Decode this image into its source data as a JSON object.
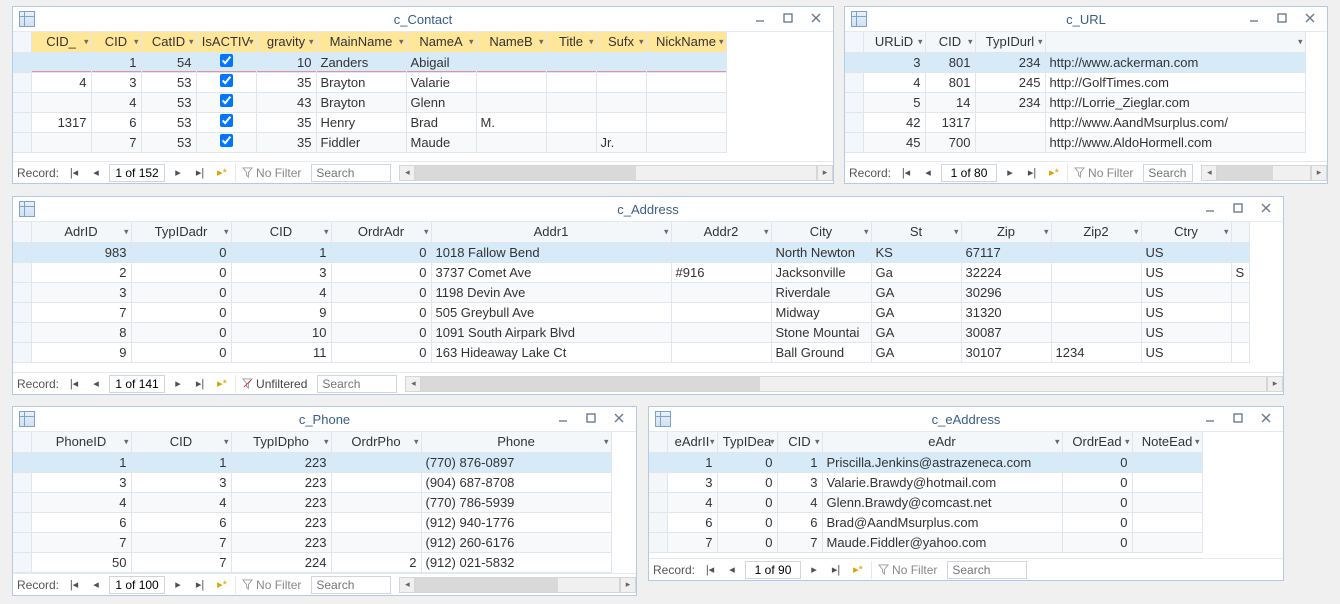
{
  "icons": {
    "minimize": "minimize",
    "maximize": "maximize",
    "close": "close"
  },
  "common": {
    "record_label": "Record:",
    "nofilter_label": "No Filter",
    "unfiltered_label": "Unfiltered",
    "search_placeholder": "Search"
  },
  "windows": {
    "contact": {
      "title": "c_Contact",
      "record": "1 of 152",
      "headers": [
        "CID_",
        "CID",
        "CatID",
        "IsACTIV",
        "gravity",
        "MainName",
        "NameA",
        "NameB",
        "Title",
        "Sufx",
        "NickName"
      ],
      "rows": [
        {
          "sel": true,
          "pink": true,
          "CID_": "",
          "CID": "1",
          "CatID": "54",
          "IsACTIV": true,
          "gravity": "10",
          "MainName": "Zanders",
          "NameA": "Abigail",
          "NameB": "",
          "Title": "",
          "Sufx": "",
          "NickName": ""
        },
        {
          "CID_": "4",
          "CID": "3",
          "CatID": "53",
          "IsACTIV": true,
          "gravity": "35",
          "MainName": "Brayton",
          "NameA": "Valarie",
          "NameB": "",
          "Title": "",
          "Sufx": "",
          "NickName": ""
        },
        {
          "CID_": "",
          "CID": "4",
          "CatID": "53",
          "IsACTIV": true,
          "gravity": "43",
          "MainName": "Brayton",
          "NameA": "Glenn",
          "NameB": "",
          "Title": "",
          "Sufx": "",
          "NickName": ""
        },
        {
          "CID_": "1317",
          "CID": "6",
          "CatID": "53",
          "IsACTIV": true,
          "gravity": "35",
          "MainName": "Henry",
          "NameA": "Brad",
          "NameB": "M.",
          "Title": "",
          "Sufx": "",
          "NickName": ""
        },
        {
          "CID_": "",
          "CID": "7",
          "CatID": "53",
          "IsACTIV": true,
          "gravity": "35",
          "MainName": "Fiddler",
          "NameA": "Maude",
          "NameB": "",
          "Title": "",
          "Sufx": "Jr.",
          "NickName": ""
        }
      ]
    },
    "url": {
      "title": "c_URL",
      "record": "1 of 80",
      "headers": [
        "URLiD",
        "CID",
        "TypIDurl",
        ""
      ],
      "rows": [
        {
          "sel": true,
          "URLiD": "3",
          "CID": "801",
          "TypIDurl": "234",
          "url": "http://www.ackerman.com"
        },
        {
          "URLiD": "4",
          "CID": "801",
          "TypIDurl": "245",
          "url": "http://GolfTimes.com"
        },
        {
          "URLiD": "5",
          "CID": "14",
          "TypIDurl": "234",
          "url": "http://Lorrie_Zieglar.com"
        },
        {
          "URLiD": "42",
          "CID": "1317",
          "TypIDurl": "",
          "url": "http://www.AandMsurplus.com/"
        },
        {
          "URLiD": "45",
          "CID": "700",
          "TypIDurl": "",
          "url": "http://www.AldoHormell.com"
        }
      ]
    },
    "address": {
      "title": "c_Address",
      "record": "1 of 141",
      "filter": "Unfiltered",
      "headers": [
        "AdrID",
        "TypIDadr",
        "CID",
        "OrdrAdr",
        "Addr1",
        "Addr2",
        "City",
        "St",
        "Zip",
        "Zip2",
        "Ctry"
      ],
      "rows": [
        {
          "sel": true,
          "AdrID": "983",
          "TypIDadr": "0",
          "CID": "1",
          "OrdrAdr": "0",
          "Addr1": "1018 Fallow Bend",
          "Addr2": "",
          "City": "North Newton",
          "St": "KS",
          "Zip": "67117",
          "Zip2": "",
          "Ctry": "US",
          "extra": ""
        },
        {
          "AdrID": "2",
          "TypIDadr": "0",
          "CID": "3",
          "OrdrAdr": "0",
          "Addr1": "3737 Comet Ave",
          "Addr2": "#916",
          "City": "Jacksonville",
          "St": "Ga",
          "Zip": "32224",
          "Zip2": "",
          "Ctry": "US",
          "extra": "S"
        },
        {
          "AdrID": "3",
          "TypIDadr": "0",
          "CID": "4",
          "OrdrAdr": "0",
          "Addr1": "1198 Devin Ave",
          "Addr2": "",
          "City": "Riverdale",
          "St": "GA",
          "Zip": "30296",
          "Zip2": "",
          "Ctry": "US",
          "extra": ""
        },
        {
          "AdrID": "7",
          "TypIDadr": "0",
          "CID": "9",
          "OrdrAdr": "0",
          "Addr1": "505 Greybull Ave",
          "Addr2": "",
          "City": "Midway",
          "St": "GA",
          "Zip": "31320",
          "Zip2": "",
          "Ctry": "US",
          "extra": ""
        },
        {
          "AdrID": "8",
          "TypIDadr": "0",
          "CID": "10",
          "OrdrAdr": "0",
          "Addr1": "1091 South Airpark Blvd",
          "Addr2": "",
          "City": "Stone Mountai",
          "St": "GA",
          "Zip": "30087",
          "Zip2": "",
          "Ctry": "US",
          "extra": ""
        },
        {
          "AdrID": "9",
          "TypIDadr": "0",
          "CID": "11",
          "OrdrAdr": "0",
          "Addr1": "163 Hideaway Lake Ct",
          "Addr2": "",
          "City": "Ball Ground",
          "St": "GA",
          "Zip": "30107",
          "Zip2": "1234",
          "Ctry": "US",
          "extra": ""
        }
      ]
    },
    "phone": {
      "title": "c_Phone",
      "record": "1 of 100",
      "headers": [
        "PhoneID",
        "CID",
        "TypIDpho",
        "OrdrPho",
        "Phone"
      ],
      "rows": [
        {
          "sel": true,
          "PhoneID": "1",
          "CID": "1",
          "TypIDpho": "223",
          "OrdrPho": "",
          "Phone": "(770) 876-0897"
        },
        {
          "PhoneID": "3",
          "CID": "3",
          "TypIDpho": "223",
          "OrdrPho": "",
          "Phone": "(904) 687-8708"
        },
        {
          "PhoneID": "4",
          "CID": "4",
          "TypIDpho": "223",
          "OrdrPho": "",
          "Phone": "(770) 786-5939"
        },
        {
          "PhoneID": "6",
          "CID": "6",
          "TypIDpho": "223",
          "OrdrPho": "",
          "Phone": "(912) 940-1776"
        },
        {
          "PhoneID": "7",
          "CID": "7",
          "TypIDpho": "223",
          "OrdrPho": "",
          "Phone": "(912) 260-6176"
        },
        {
          "PhoneID": "50",
          "CID": "7",
          "TypIDpho": "224",
          "OrdrPho": "2",
          "Phone": "(912) 021-5832"
        }
      ]
    },
    "eaddress": {
      "title": "c_eAddress",
      "record": "1 of 90",
      "headers": [
        "eAdrII",
        "TypIDea",
        "CID",
        "eAdr",
        "OrdrEad",
        "NoteEad"
      ],
      "rows": [
        {
          "sel": true,
          "eAdrII": "1",
          "TypIDea": "0",
          "CID": "1",
          "eAdr": "Priscilla.Jenkins@astrazeneca.com",
          "OrdrEad": "0",
          "NoteEad": ""
        },
        {
          "eAdrII": "3",
          "TypIDea": "0",
          "CID": "3",
          "eAdr": "Valarie.Brawdy@hotmail.com",
          "OrdrEad": "0",
          "NoteEad": ""
        },
        {
          "eAdrII": "4",
          "TypIDea": "0",
          "CID": "4",
          "eAdr": "Glenn.Brawdy@comcast.net",
          "OrdrEad": "0",
          "NoteEad": ""
        },
        {
          "eAdrII": "6",
          "TypIDea": "0",
          "CID": "6",
          "eAdr": "Brad@AandMsurplus.com",
          "OrdrEad": "0",
          "NoteEad": ""
        },
        {
          "eAdrII": "7",
          "TypIDea": "0",
          "CID": "7",
          "eAdr": "Maude.Fiddler@yahoo.com",
          "OrdrEad": "0",
          "NoteEad": ""
        }
      ]
    }
  }
}
